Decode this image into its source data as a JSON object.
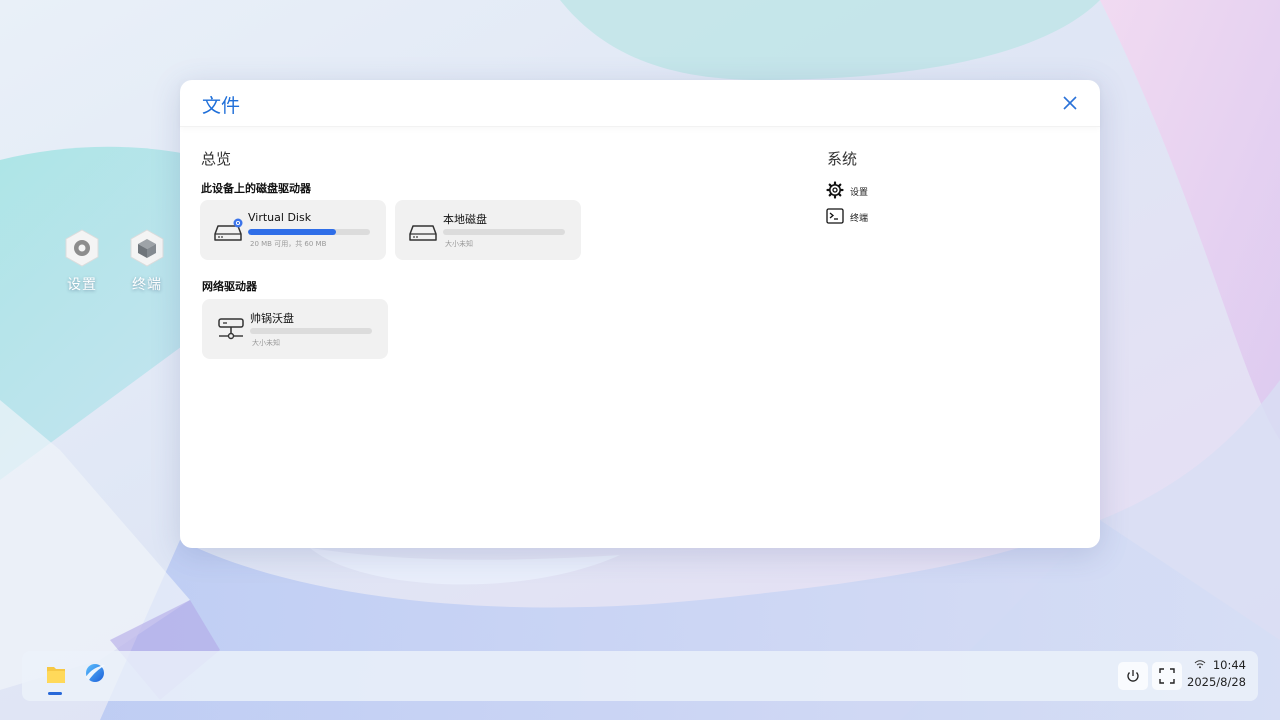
{
  "desktop": {
    "icons": [
      {
        "label": "设置",
        "icon": "gear-icon"
      },
      {
        "label": "终端",
        "icon": "cube-icon"
      }
    ]
  },
  "window": {
    "title": "文件",
    "overview": {
      "title": "总览",
      "local_section": "此设备上的磁盘驱动器",
      "network_section": "网络驱动器",
      "drives": [
        {
          "name": "Virtual Disk",
          "info": "20 MB 可用，共 60 MB",
          "used_fraction": 0.72,
          "icon": "hard-drive-icon"
        },
        {
          "name": "本地磁盘",
          "info": "大小未知",
          "used_fraction": 0,
          "icon": "hard-drive-icon"
        }
      ],
      "network_drives": [
        {
          "name": "帅锅沃盘",
          "info": "大小未知",
          "used_fraction": 0,
          "icon": "network-drive-icon"
        }
      ]
    },
    "system": {
      "title": "系统",
      "items": [
        {
          "label": "设置",
          "icon": "gear-icon"
        },
        {
          "label": "终端",
          "icon": "terminal-icon"
        }
      ]
    }
  },
  "taskbar": {
    "apps": [
      {
        "name": "files-app",
        "icon": "folder-icon",
        "active": true
      },
      {
        "name": "browser-app",
        "icon": "browser-icon",
        "active": false
      }
    ],
    "time": "10:44",
    "date": "2025/8/28"
  },
  "colors": {
    "accent": "#2f6ee8",
    "title": "#1f6fd9"
  }
}
